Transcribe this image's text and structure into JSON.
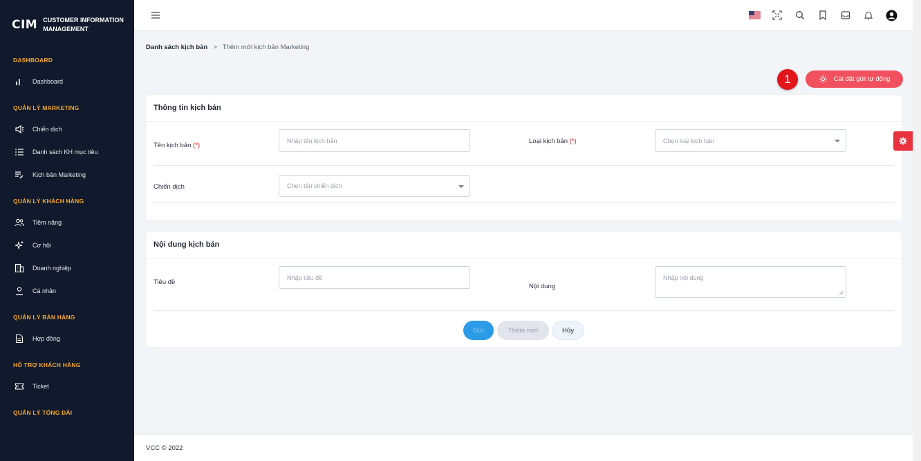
{
  "brand": {
    "mark": "CIM",
    "line1": "CUSTOMER INFORMATION",
    "line2": "MANAGEMENT"
  },
  "sidebar": {
    "sections": [
      {
        "title": "DASHBOARD",
        "items": [
          {
            "label": "Dashboard",
            "icon": "bar-chart-icon"
          }
        ]
      },
      {
        "title": "QUẢN LÝ MARKETING",
        "items": [
          {
            "label": "Chiến dịch",
            "icon": "megaphone-icon"
          },
          {
            "label": "Danh sách KH mục tiêu",
            "icon": "list-icon"
          },
          {
            "label": "Kịch bản Marketing",
            "icon": "edit-list-icon"
          }
        ]
      },
      {
        "title": "QUẢN LÝ KHÁCH HÀNG",
        "items": [
          {
            "label": "Tiềm năng",
            "icon": "users-icon"
          },
          {
            "label": "Cơ hội",
            "icon": "sparkle-icon"
          },
          {
            "label": "Doanh nghiệp",
            "icon": "building-icon"
          },
          {
            "label": "Cá nhân",
            "icon": "user-icon"
          }
        ]
      },
      {
        "title": "QUẢN LÝ BÁN HÀNG",
        "items": [
          {
            "label": "Hợp đồng",
            "icon": "document-icon"
          }
        ]
      },
      {
        "title": "HỖ TRỢ KHÁCH HÀNG",
        "items": [
          {
            "label": "Ticket",
            "icon": "ticket-icon"
          }
        ]
      },
      {
        "title": "QUẢN LÝ TỔNG ĐÀI",
        "items": []
      }
    ]
  },
  "topbar": {
    "icons": [
      "us-flag-icon",
      "fullscreen-icon",
      "search-icon",
      "bookmark-icon",
      "inbox-icon",
      "bell-icon",
      "user-avatar-icon"
    ]
  },
  "breadcrumb": {
    "parent": "Danh sách kịch bản",
    "separator": ">",
    "current": "Thêm mới kịch bản Marketing"
  },
  "annotation": {
    "number": "1"
  },
  "auto_button": {
    "label": "Cài đặt gửi tự động"
  },
  "info_card": {
    "title": "Thông tin kịch bản",
    "name_label": "Tên kịch bản",
    "name_req": "(*)",
    "name_placeholder": "Nhập tên kịch bản",
    "type_label": "Loại kịch bản",
    "type_req": "(*)",
    "type_placeholder": "Chọn loại kịch bản",
    "campaign_label": "Chiến dịch",
    "campaign_placeholder": "Chọn tên chiến dịch"
  },
  "content_card": {
    "title": "Nội dung kịch bản",
    "subject_label": "Tiêu đề",
    "subject_placeholder": "Nhập tiêu đề",
    "body_label": "Nội dung",
    "body_placeholder": "Nhập nội dung",
    "send_label": "Gửi",
    "add_label": "Thêm mới",
    "cancel_label": "Hủy"
  },
  "footer": {
    "text": "VCC © 2022"
  },
  "colors": {
    "sidebar_bg": "#111a2c",
    "section_title": "#f5a623",
    "accent_red": "#f1515e",
    "primary_blue": "#2b9be6"
  }
}
